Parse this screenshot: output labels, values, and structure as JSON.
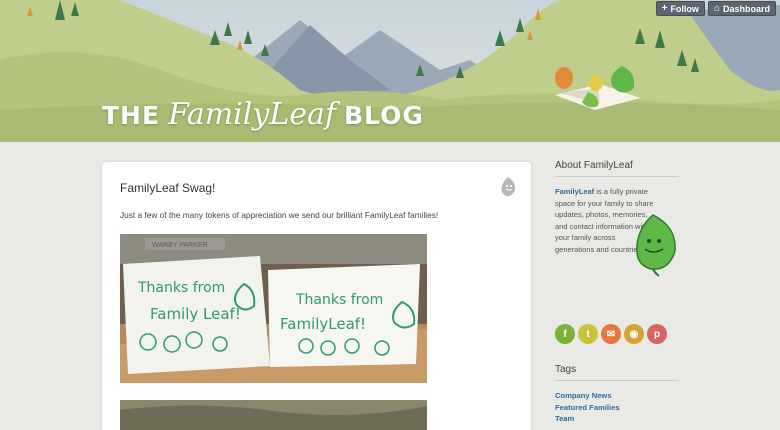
{
  "topbar": {
    "follow_label": "Follow",
    "dashboard_label": "Dashboard"
  },
  "header": {
    "title_prefix": "THE",
    "title_name": "FamilyLeaf",
    "title_suffix": "BLOG"
  },
  "post": {
    "title": "FamilyLeaf Swag!",
    "body": "Just a few of the many tokens of appreciation we send our brilliant FamilyLeaf families!",
    "photo_card_left": [
      "Thanks from",
      "Family Leaf!"
    ],
    "photo_card_right": [
      "Thanks from",
      "FamilyLeaf!"
    ],
    "photo_brand": "WARBY PARKER"
  },
  "sidebar": {
    "about_heading": "About FamilyLeaf",
    "about_brand": "FamilyLeaf",
    "about_text": " is a fully private space for your family to share updates, photos, memories, and contact information with your family across generations and countries!",
    "social": [
      {
        "name": "facebook-icon",
        "glyph": "f",
        "color": "#7ab23a"
      },
      {
        "name": "twitter-icon",
        "glyph": "t",
        "color": "#c9c23c"
      },
      {
        "name": "email-icon",
        "glyph": "✉",
        "color": "#e07a3e"
      },
      {
        "name": "rss-icon",
        "glyph": "◉",
        "color": "#d5a23a"
      },
      {
        "name": "pinterest-icon",
        "glyph": "p",
        "color": "#d66666"
      }
    ],
    "tags_heading": "Tags",
    "tags": [
      "Company News",
      "Featured Families",
      "Team"
    ]
  },
  "colors": {
    "link": "#2e6aa0",
    "leaf_green": "#5fb748",
    "header_grass": "#b6c77c"
  }
}
